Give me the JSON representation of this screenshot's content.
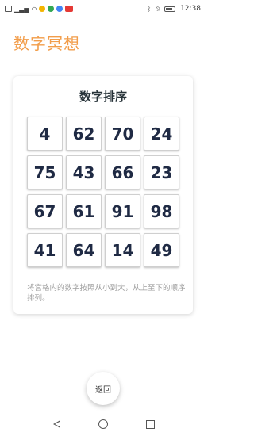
{
  "status_bar": {
    "time": "12:38"
  },
  "app": {
    "title": "数字冥想"
  },
  "card": {
    "title": "数字排序",
    "grid": [
      [
        "4",
        "62",
        "70",
        "24"
      ],
      [
        "75",
        "43",
        "66",
        "23"
      ],
      [
        "67",
        "61",
        "91",
        "98"
      ],
      [
        "41",
        "64",
        "14",
        "49"
      ]
    ],
    "hint": "将宫格内的数字按照从小到大，从上至下的顺序排列。"
  },
  "back_button": {
    "label": "返回"
  }
}
